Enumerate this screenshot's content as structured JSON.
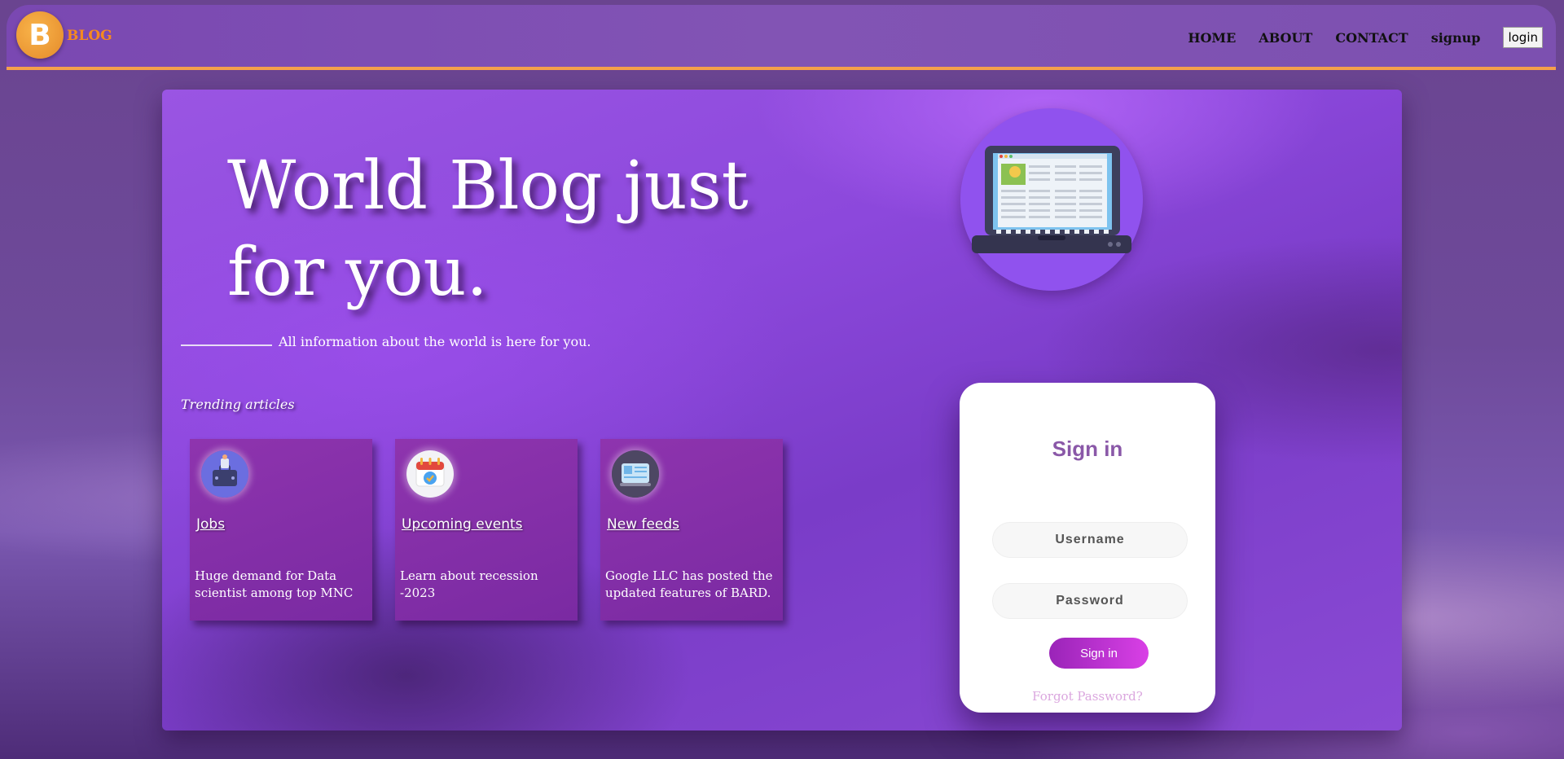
{
  "nav": {
    "logo_letter": "B",
    "brand": "BLOG",
    "links": [
      "HOME",
      "ABOUT",
      "CONTACT",
      "signup"
    ],
    "login_label": "login"
  },
  "hero": {
    "title": "World Blog just for you.",
    "subtitle": "All information about the world is here for you.",
    "trending_label": "Trending articles"
  },
  "cards": [
    {
      "title": "Jobs",
      "text": "Huge demand for Data scientist among top MNC",
      "icon": "briefcase-icon"
    },
    {
      "title": "Upcoming events",
      "text": "Learn about recession -2023",
      "icon": "calendar-icon"
    },
    {
      "title": "New feeds",
      "text": "Google LLC has posted the updated features of BARD.",
      "icon": "news-icon"
    }
  ],
  "signin": {
    "title": "Sign in",
    "username_placeholder": "Username",
    "password_placeholder": "Password",
    "button_label": "Sign in",
    "forgot_label": "Forgot Password?"
  },
  "colors": {
    "accent_orange": "#f5a04b",
    "brand_orange": "#f58a1f",
    "signin_title": "#8a58a8",
    "button_gradient_start": "#9a24b8",
    "button_gradient_end": "#d940e6"
  }
}
